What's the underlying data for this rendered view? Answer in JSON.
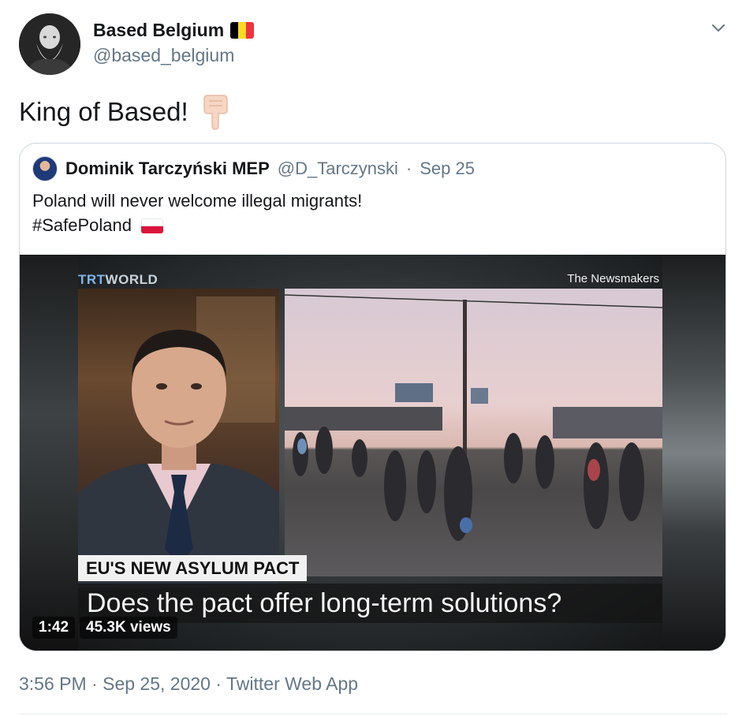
{
  "author": {
    "display_name": "Based Belgium",
    "handle": "@based_belgium",
    "flag_colors": [
      "#000000",
      "#fdda24",
      "#ef3340"
    ]
  },
  "tweet": {
    "text": "King of Based!",
    "emoji_icon": "pointing-down-hand-icon"
  },
  "quoted": {
    "display_name": "Dominik Tarczyński MEP",
    "handle": "@D_Tarczynski",
    "separator": "·",
    "date": "Sep 25",
    "line1": "Poland will never welcome illegal migrants!",
    "line2": "#SafePoland",
    "flag_colors": [
      "#ffffff",
      "#dc143c"
    ],
    "video": {
      "channel_a": "TRT",
      "channel_b": "WORLD",
      "program": "The Newsmakers",
      "lower_third": "EU'S NEW ASYLUM PACT",
      "headline": "Does the pact offer long-term solutions?",
      "duration": "1:42",
      "views": "45.3K views"
    }
  },
  "footer": {
    "time": "3:56 PM",
    "dot1": "·",
    "date": "Sep 25, 2020",
    "dot2": "·",
    "source": "Twitter Web App"
  },
  "colors": {
    "text": "#14171a",
    "secondary": "#657786",
    "border": "#ccd6dd"
  }
}
